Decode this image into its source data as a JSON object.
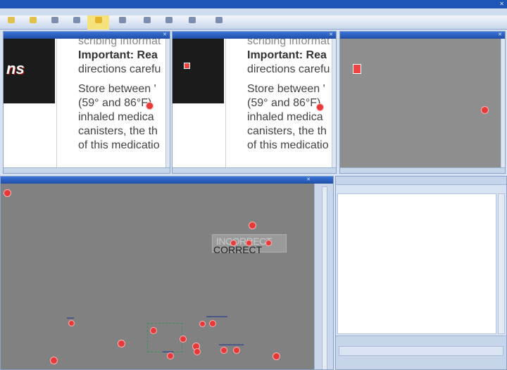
{
  "app": {
    "title": "",
    "close_glyph": "✕"
  },
  "menu": [],
  "toolbar": {
    "buttons": [
      {
        "name": "tb-1",
        "label": ""
      },
      {
        "name": "tb-2",
        "label": ""
      },
      {
        "name": "tb-3",
        "label": ""
      },
      {
        "name": "tb-4",
        "label": ""
      },
      {
        "name": "tb-5",
        "label": "",
        "active": true
      },
      {
        "name": "tb-6",
        "label": ""
      },
      {
        "name": "tb-7",
        "label": ""
      },
      {
        "name": "tb-8",
        "label": ""
      },
      {
        "name": "tb-9",
        "label": ""
      },
      {
        "name": "tb-10",
        "label": ""
      }
    ]
  },
  "panes": {
    "reference": {
      "title": "",
      "close": "✕",
      "logo": "ns",
      "text_lines": [
        "scribing informat",
        "Important: Rea",
        "directions carefu",
        "Store between '",
        "(59° and 86°F)",
        "inhaled medica",
        "canisters, the th",
        "of this medicatio"
      ]
    },
    "scanned": {
      "title": "",
      "close": "✕",
      "logo": "",
      "text_lines": [
        "scribing informat",
        "Important: Rea",
        "directions carefu",
        "Store between '",
        "(59° and 86°F)",
        "inhaled medica",
        "canisters, the th",
        "of this medicatio"
      ]
    },
    "difference": {
      "title": "",
      "close": "✕"
    },
    "overlay": {
      "title": "",
      "close": "✕",
      "word_top": "INCORRECT",
      "word_bottom": "CORRECT"
    }
  },
  "colors": {
    "marker": "#e63a3a",
    "titlebar": "#1e56b8",
    "pane_header": "#2a5fc0"
  }
}
